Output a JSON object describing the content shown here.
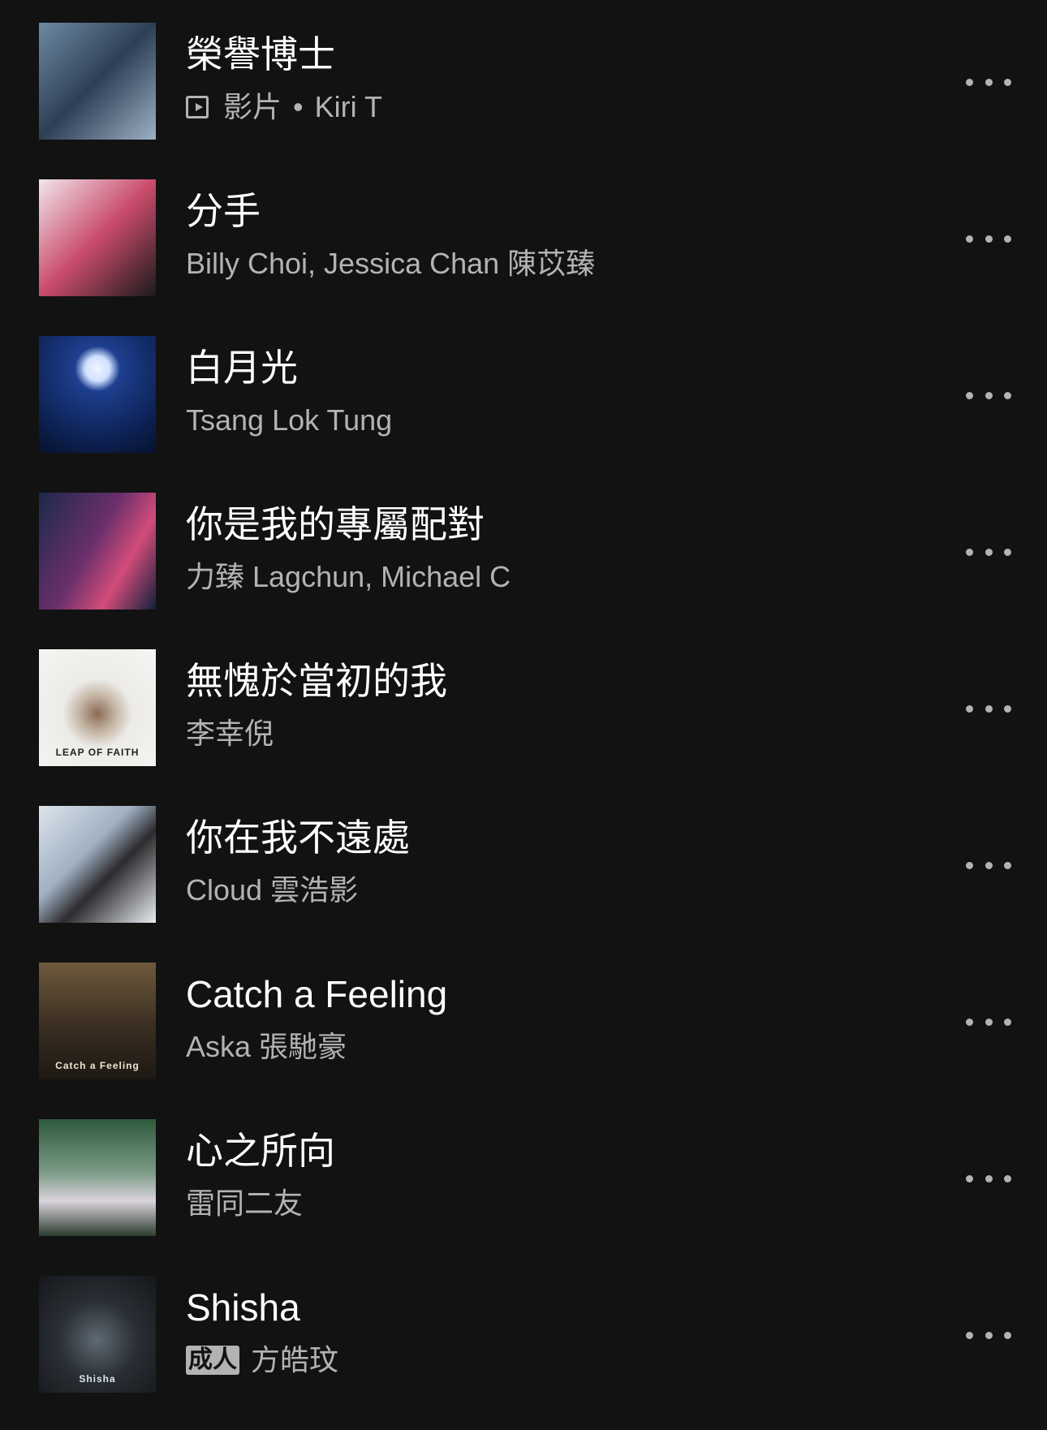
{
  "tracks": [
    {
      "title": "榮譽博士",
      "type_label": "影片",
      "artist": "Kiri T",
      "is_video": true,
      "explicit": false,
      "art": {
        "bg": "linear-gradient(135deg,#6d8aa3 0%,#2e3f55 50%,#9db1c4 100%)"
      }
    },
    {
      "title": "分手",
      "artist": "Billy Choi, Jessica Chan 陳苡臻",
      "is_video": false,
      "explicit": false,
      "art": {
        "bg": "linear-gradient(135deg,#f2e6ec 0%,#c94b6b 50%,#1b1b1b 100%)"
      }
    },
    {
      "title": "白月光",
      "artist": "Tsang Lok Tung",
      "is_video": false,
      "explicit": false,
      "art": {
        "bg": "radial-gradient(circle at 50% 28%,#f1f5ff 0,#cfe0ff 12%,#1d3f8f 22%,#0d2153 70%,#07122c 100%)"
      }
    },
    {
      "title": "你是我的專屬配對",
      "artist": "力臻 Lagchun, Michael C",
      "is_video": false,
      "explicit": false,
      "art": {
        "bg": "linear-gradient(120deg,#1c2a4a 0%,#6a2f6b 45%,#d24c7a 70%,#13203b 100%)"
      }
    },
    {
      "title": "無愧於當初的我",
      "artist": "李幸倪",
      "is_video": false,
      "explicit": false,
      "art": {
        "bg": "radial-gradient(circle at 50% 55%,#8b6b55 0,#c7b8a8 22%,#ecebe8 40%,#f5f5f3 100%)",
        "text": "LEAP OF FAITH",
        "text_color": "#222"
      }
    },
    {
      "title": "你在我不遠處",
      "artist": "Cloud 雲浩影",
      "is_video": false,
      "explicit": false,
      "art": {
        "bg": "linear-gradient(135deg,#dde4ec 0%,#9fb0c2 40%,#2d2b2e 60%,#e8edf2 100%)"
      }
    },
    {
      "title": "Catch a Feeling",
      "artist": "Aska 張馳豪",
      "is_video": false,
      "explicit": false,
      "art": {
        "bg": "linear-gradient(180deg,#6e5a3c 0%,#3a2e22 55%,#1d1813 100%)",
        "text": "Catch a Feeling",
        "text_color": "#f1e6cf"
      }
    },
    {
      "title": "心之所向",
      "artist": "雷同二友",
      "is_video": false,
      "explicit": false,
      "art": {
        "bg": "linear-gradient(180deg,#2f5a3d 0%,#7a9a84 45%,#d9d3dc 70%,#2c3d2f 100%)"
      }
    },
    {
      "title": "Shisha",
      "artist": "方皓玟",
      "is_video": false,
      "explicit": true,
      "explicit_label": "成人",
      "art": {
        "bg": "radial-gradient(circle at 50% 55%,#5f6a73 0,#2a2f35 45%,#14171a 100%)",
        "text": "Shisha",
        "text_color": "#dfe7ee"
      }
    }
  ],
  "colors": {
    "background": "#121212",
    "primary_text": "#ffffff",
    "secondary_text": "#b3b3b3"
  },
  "icons": {
    "more": "more-horizontal-icon",
    "video": "video-play-icon"
  }
}
